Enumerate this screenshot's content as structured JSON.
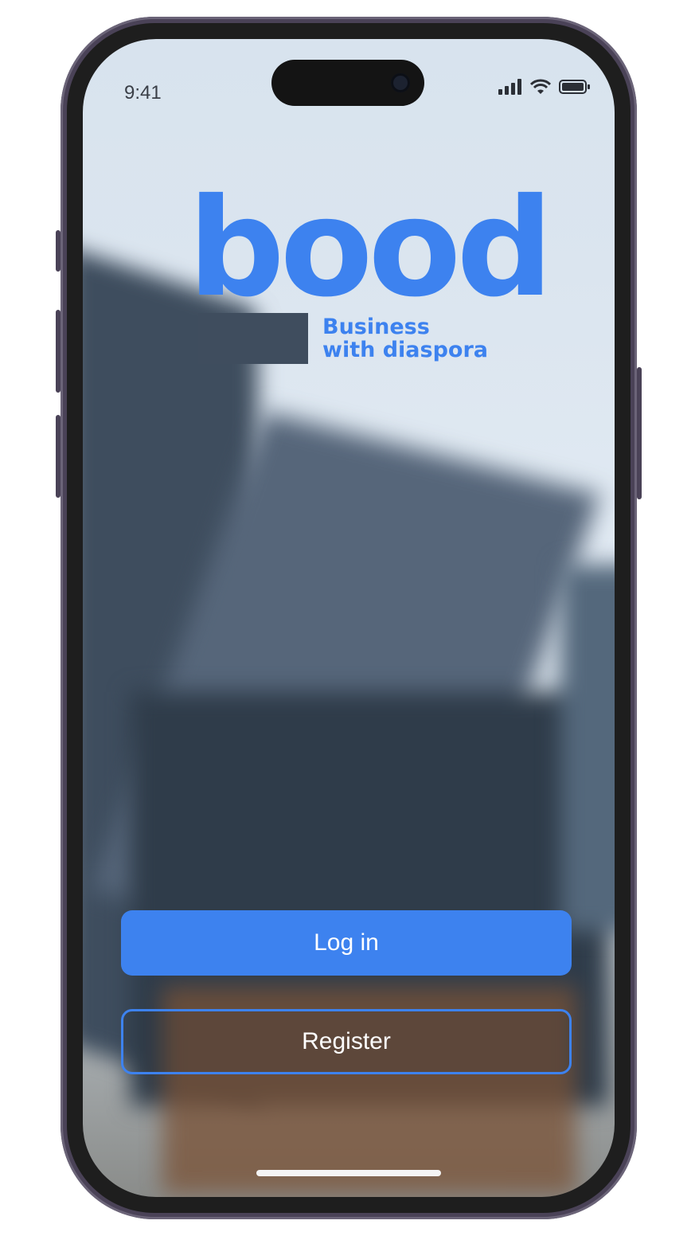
{
  "status_bar": {
    "time": "9:41",
    "icons": [
      "signal-icon",
      "wifi-icon",
      "battery-icon"
    ]
  },
  "brand": {
    "logo_text": "bood",
    "tagline_line1": "Business",
    "tagline_line2": "with diaspora",
    "accent_color": "#3d82ef"
  },
  "actions": {
    "login_label": "Log in",
    "register_label": "Register"
  }
}
